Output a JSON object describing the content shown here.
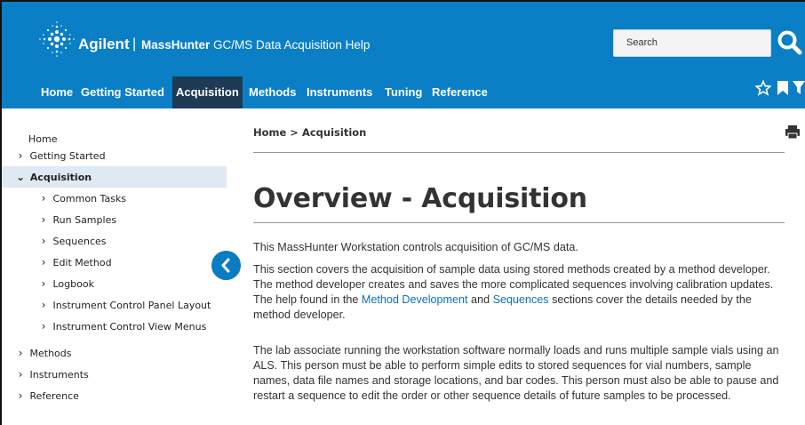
{
  "header": {
    "brand": "Agilent",
    "separator": "|",
    "product_bold": "MassHunter",
    "product_rest": " GC/MS Data Acquisition Help",
    "search_placeholder": "Search"
  },
  "nav": {
    "items": [
      {
        "label": "Home"
      },
      {
        "label": "Getting Started"
      },
      {
        "label": "Acquisition",
        "active": true
      },
      {
        "label": "Methods"
      },
      {
        "label": "Instruments"
      },
      {
        "label": "Tuning"
      },
      {
        "label": "Reference"
      }
    ],
    "icons": [
      "star-outline-icon",
      "bookmark-icon",
      "filter-icon"
    ]
  },
  "sidebar": {
    "items": [
      {
        "label": "Home",
        "chevron": ""
      },
      {
        "label": "Getting Started",
        "chevron": ">"
      },
      {
        "label": "Acquisition",
        "chevron": "v",
        "active": true
      },
      {
        "label": "Common Tasks",
        "chevron": ">"
      },
      {
        "label": "Run Samples",
        "chevron": ">"
      },
      {
        "label": "Sequences",
        "chevron": ">"
      },
      {
        "label": "Edit Method",
        "chevron": ">"
      },
      {
        "label": "Logbook",
        "chevron": ">"
      },
      {
        "label": "Instrument Control Panel Layout",
        "chevron": ">"
      },
      {
        "label": "Instrument Control View Menus",
        "chevron": ">"
      },
      {
        "label": "Methods",
        "chevron": ">"
      },
      {
        "label": "Instruments",
        "chevron": ">"
      },
      {
        "label": "Reference",
        "chevron": ">"
      }
    ],
    "collapse_icon": "chevron-left-icon"
  },
  "content": {
    "breadcrumb": "Home > Acquisition",
    "title": "Overview - Acquisition",
    "p1": "This MassHunter Workstation controls acquisition of GC/MS data.",
    "p2_a": "This section covers the acquisition of sample data using stored methods created by a method developer. The method developer creates and saves the more complicated sequences involving calibration updates. The help found in the ",
    "p2_link1": "Method Development",
    "p2_b": " and ",
    "p2_link2": "Sequences",
    "p2_c": " sections cover the details needed by the method developer.",
    "p3": "The lab associate running the workstation software normally loads and runs multiple sample vials using an ALS. This person must be able to perform simple edits to stored sequences for vial numbers, sample names, data file names and storage locations, and bar codes. This person must also be able to pause and restart a sequence to edit the order or other sequence details of future samples to be processed."
  },
  "colors": {
    "header_blue": "#0a7fc6",
    "nav_active": "#1f3a55",
    "sidebar_active": "#dfe9f3",
    "link": "#0b72b8"
  }
}
